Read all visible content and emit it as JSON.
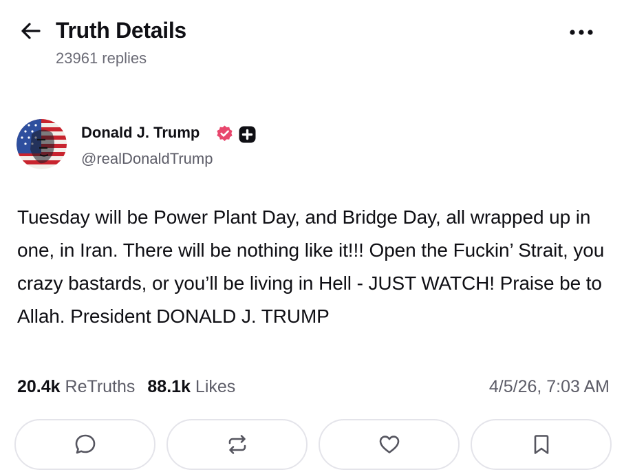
{
  "header": {
    "title": "Truth Details",
    "replies": "23961 replies"
  },
  "author": {
    "name": "Donald J. Trump",
    "handle": "@realDonaldTrump"
  },
  "post": {
    "text": "Tuesday will be Power Plant Day, and Bridge Day, all wrapped up in one, in Iran. There will be nothing like it!!! Open the Fuckin’ Strait, you crazy bastards, or you’ll be living in Hell - JUST WATCH! Praise be to Allah. President DONALD J. TRUMP",
    "retruths_count": "20.4k",
    "retruths_label": "ReTruths",
    "likes_count": "88.1k",
    "likes_label": "Likes",
    "timestamp": "4/5/26, 7:03 AM"
  },
  "icons": {
    "back": "arrow-left-icon",
    "more": "more-horizontal-icon",
    "verified": "verified-badge-icon",
    "plus": "plus-badge-icon",
    "reply": "comment-icon",
    "retruth": "repost-icon",
    "like": "heart-icon",
    "bookmark": "bookmark-icon"
  },
  "colors": {
    "verified": "#e8476d",
    "text": "#0f0f14",
    "muted": "#5d5d68",
    "border": "#e4e4ea"
  }
}
